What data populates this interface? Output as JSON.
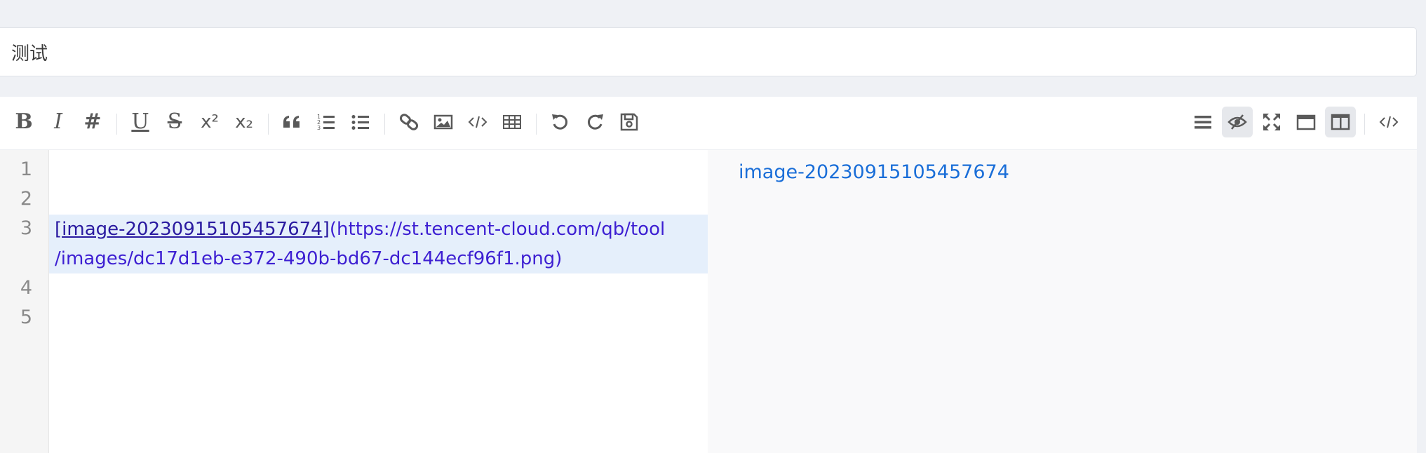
{
  "title_input": {
    "value": "测试"
  },
  "toolbar": {
    "left": [
      {
        "name": "bold",
        "label": "B"
      },
      {
        "name": "italic",
        "label": "I"
      },
      {
        "name": "header",
        "label": "#"
      },
      {
        "name": "underline",
        "label": "U"
      },
      {
        "name": "strikethrough",
        "label": "S"
      },
      {
        "name": "superscript",
        "label": "x²"
      },
      {
        "name": "subscript",
        "label": "x₂"
      },
      {
        "name": "quote",
        "icon": "quote-icon"
      },
      {
        "name": "ordered-list",
        "icon": "ordered-list-icon"
      },
      {
        "name": "unordered-list",
        "icon": "unordered-list-icon"
      },
      {
        "name": "link",
        "icon": "link-icon"
      },
      {
        "name": "image",
        "icon": "image-icon"
      },
      {
        "name": "code",
        "icon": "code-icon"
      },
      {
        "name": "table",
        "icon": "table-icon"
      },
      {
        "name": "undo",
        "icon": "undo-icon"
      },
      {
        "name": "redo",
        "icon": "redo-icon"
      },
      {
        "name": "save",
        "icon": "save-icon"
      }
    ],
    "right": [
      {
        "name": "navigation",
        "icon": "menu-icon",
        "active": false
      },
      {
        "name": "preview-only",
        "icon": "eye-slash-icon",
        "active": true
      },
      {
        "name": "fullscreen",
        "icon": "fullscreen-icon",
        "active": false
      },
      {
        "name": "read-mode",
        "icon": "window-icon",
        "active": false
      },
      {
        "name": "split-view",
        "icon": "columns-icon",
        "active": true
      },
      {
        "name": "html-code",
        "icon": "code-icon",
        "active": false
      }
    ]
  },
  "editor": {
    "line_numbers": [
      "1",
      "2",
      "3",
      "4",
      "5"
    ],
    "line3_link_text": "[image-20230915105457674]",
    "line3_url_part1": "(https://st.tencent-cloud.com/qb/tool",
    "line3_url_part2": "/images/dc17d1eb-e372-490b-bd67-dc144ecf96f1.png)"
  },
  "preview": {
    "link_text": "image-20230915105457674"
  }
}
